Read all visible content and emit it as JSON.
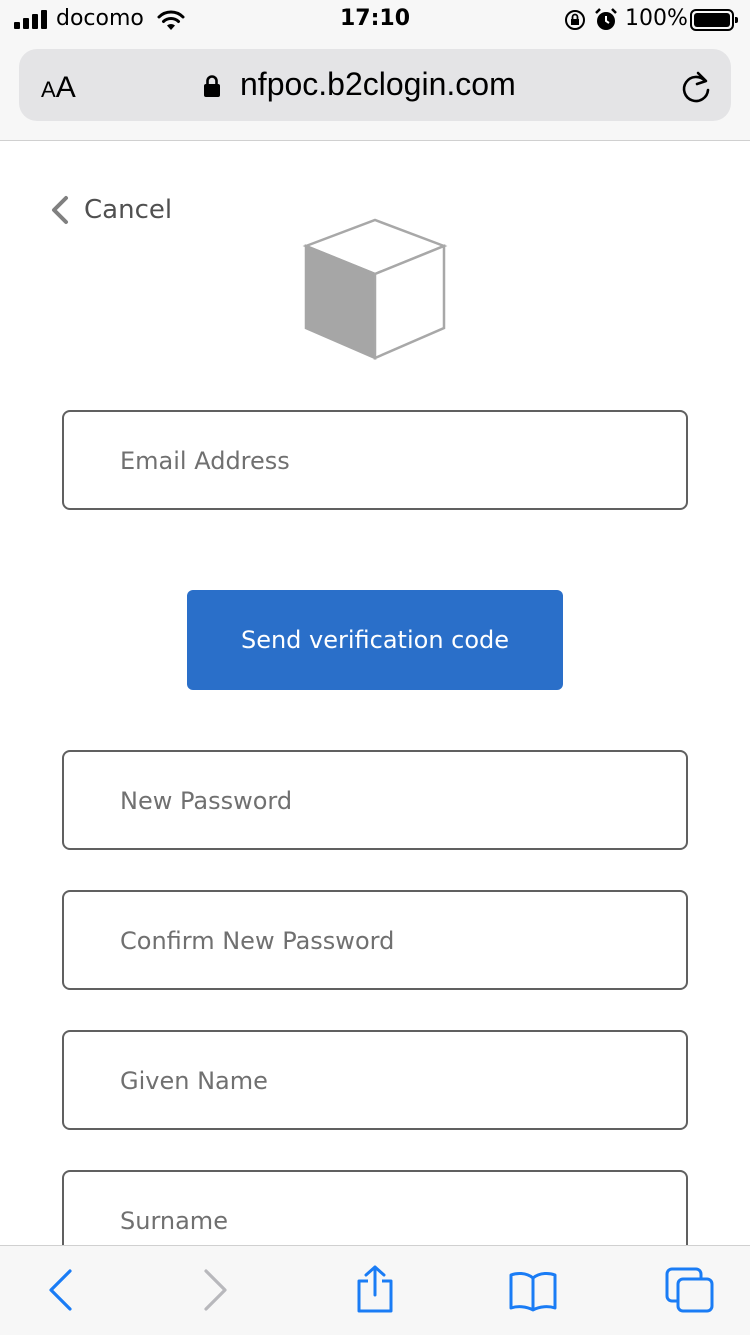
{
  "status_bar": {
    "carrier": "docomo",
    "time": "17:10",
    "battery": "100%"
  },
  "browser": {
    "text_size_small": "A",
    "text_size_large": "A",
    "url": "nfpoc.b2clogin.com"
  },
  "page": {
    "cancel_label": "Cancel",
    "email_placeholder": "Email Address",
    "send_button_label": "Send verification code",
    "new_password_placeholder": "New Password",
    "confirm_password_placeholder": "Confirm New Password",
    "given_name_placeholder": "Given Name",
    "surname_placeholder": "Surname"
  },
  "colors": {
    "accent": "#2a6fc9",
    "toolbar_icon": "#1a7cf5",
    "toolbar_icon_disabled": "#b8b8bc"
  },
  "icons": {
    "toolbar": [
      "back-icon",
      "forward-icon",
      "share-icon",
      "bookmarks-icon",
      "tabs-icon"
    ]
  }
}
